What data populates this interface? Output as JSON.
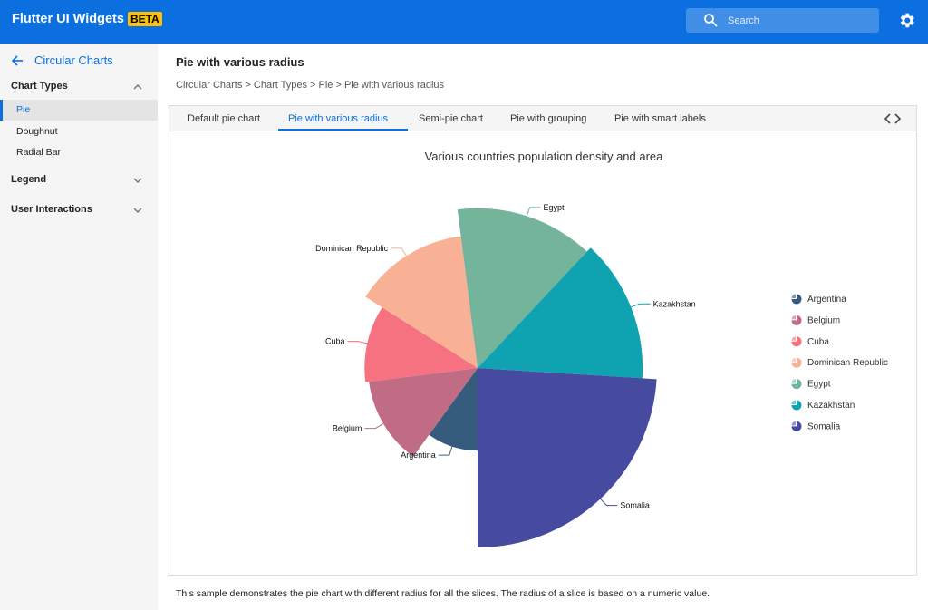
{
  "header": {
    "brand": "Flutter UI Widgets",
    "badge": "BETA",
    "search_placeholder": "Search"
  },
  "sidebar": {
    "back_label": "Circular Charts",
    "sections": [
      {
        "label": "Chart Types",
        "expanded": true
      },
      {
        "label": "Legend",
        "expanded": false
      },
      {
        "label": "User Interactions",
        "expanded": false
      }
    ],
    "items": [
      {
        "label": "Pie",
        "active": true
      },
      {
        "label": "Doughnut",
        "active": false
      },
      {
        "label": "Radial Bar",
        "active": false
      }
    ]
  },
  "main": {
    "title": "Pie with various radius",
    "breadcrumb": "Circular Charts > Chart Types > Pie > Pie with various radius",
    "tabs": [
      {
        "label": "Default pie chart",
        "active": false
      },
      {
        "label": "Pie with various radius",
        "active": true
      },
      {
        "label": "Semi-pie chart",
        "active": false
      },
      {
        "label": "Pie with grouping",
        "active": false
      },
      {
        "label": "Pie with smart labels",
        "active": false
      }
    ],
    "description": "This sample demonstrates the pie chart with different radius for all the slices. The radius of a slice is based on a numeric value."
  },
  "colors": {
    "accent": "#0c6fe0",
    "beta_badge": "#ffc107"
  },
  "chart_data": {
    "type": "pie",
    "title": "Various countries population density and area",
    "legend_position": "right",
    "start_angle_deg": 90,
    "slices": [
      {
        "name": "Argentina",
        "share": 0.1,
        "radius_rel": 0.46,
        "color": "#355c7d"
      },
      {
        "name": "Belgium",
        "share": 0.13,
        "radius_rel": 0.61,
        "color": "#c06c84"
      },
      {
        "name": "Cuba",
        "share": 0.11,
        "radius_rel": 0.63,
        "color": "#f67280"
      },
      {
        "name": "Dominican Republic",
        "share": 0.14,
        "radius_rel": 0.74,
        "color": "#f8b195"
      },
      {
        "name": "Egypt",
        "share": 0.14,
        "radius_rel": 0.89,
        "color": "#74b49b"
      },
      {
        "name": "Kazakhstan",
        "share": 0.14,
        "radius_rel": 0.92,
        "color": "#0fa3b1"
      },
      {
        "name": "Somalia",
        "share": 0.24,
        "radius_rel": 1.0,
        "color": "#474b9f"
      }
    ]
  }
}
